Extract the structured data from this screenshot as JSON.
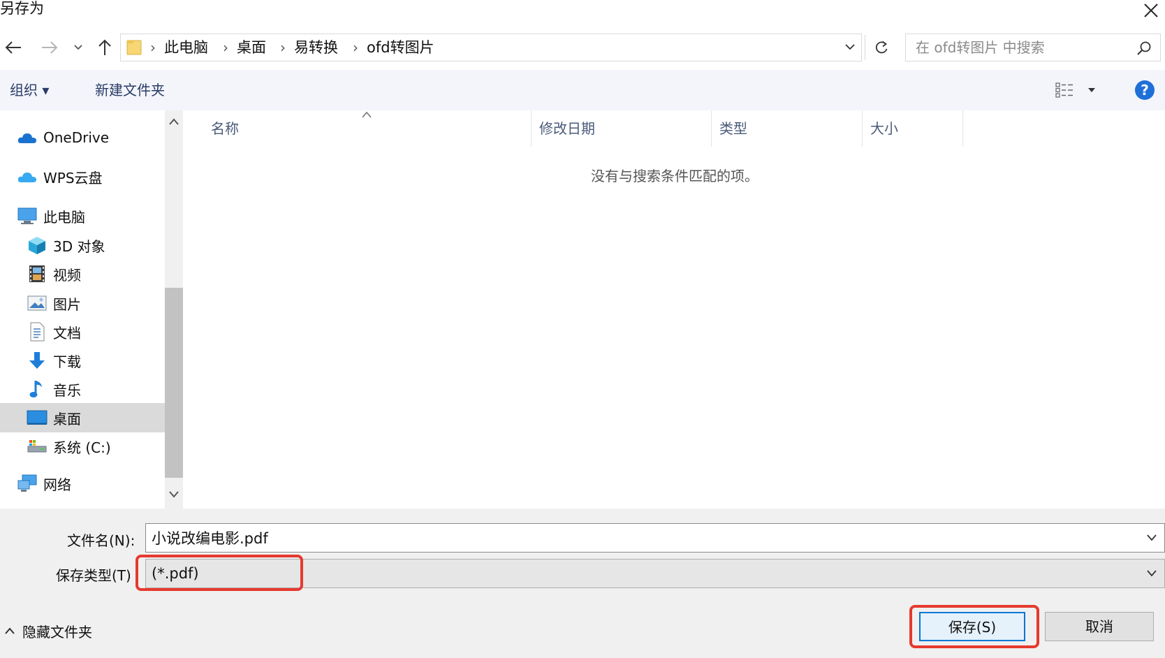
{
  "window": {
    "title": "另存为"
  },
  "address_bar": {
    "crumbs": [
      "此电脑",
      "桌面",
      "易转换",
      "ofd转图片"
    ]
  },
  "search": {
    "placeholder": "在 ofd转图片 中搜索"
  },
  "toolbar": {
    "organize": "组织 ▾",
    "new_folder": "新建文件夹"
  },
  "nav_pane": {
    "items": [
      {
        "label": "OneDrive",
        "icon": "cloud-icon"
      },
      {
        "label": "WPS云盘",
        "icon": "cloud-icon"
      },
      {
        "label": "此电脑",
        "icon": "computer-icon"
      },
      {
        "label": "3D 对象",
        "icon": "cube-icon"
      },
      {
        "label": "视频",
        "icon": "film-icon"
      },
      {
        "label": "图片",
        "icon": "picture-icon"
      },
      {
        "label": "文档",
        "icon": "document-icon"
      },
      {
        "label": "下载",
        "icon": "download-arrow-icon"
      },
      {
        "label": "音乐",
        "icon": "music-note-icon"
      },
      {
        "label": "桌面",
        "icon": "desktop-icon",
        "selected": true
      },
      {
        "label": "系统 (C:)",
        "icon": "drive-icon"
      },
      {
        "label": "网络",
        "icon": "network-icon"
      }
    ]
  },
  "file_list": {
    "columns": [
      "名称",
      "修改日期",
      "类型",
      "大小"
    ],
    "empty_message": "没有与搜索条件匹配的项。"
  },
  "save_form": {
    "filename_label": "文件名(N):",
    "filename_value": "小说改编电影.pdf",
    "filetype_label": "保存类型(T)",
    "filetype_value": "(*.pdf)"
  },
  "footer": {
    "hide_folders": "隐藏文件夹",
    "save_button": "保存(S)",
    "cancel_button": "取消"
  },
  "colors": {
    "highlight": "#e53a2e",
    "accent": "#0078d7",
    "toolbar_bg": "#f3f5fb",
    "bottom_bg": "#f0f0f0"
  }
}
